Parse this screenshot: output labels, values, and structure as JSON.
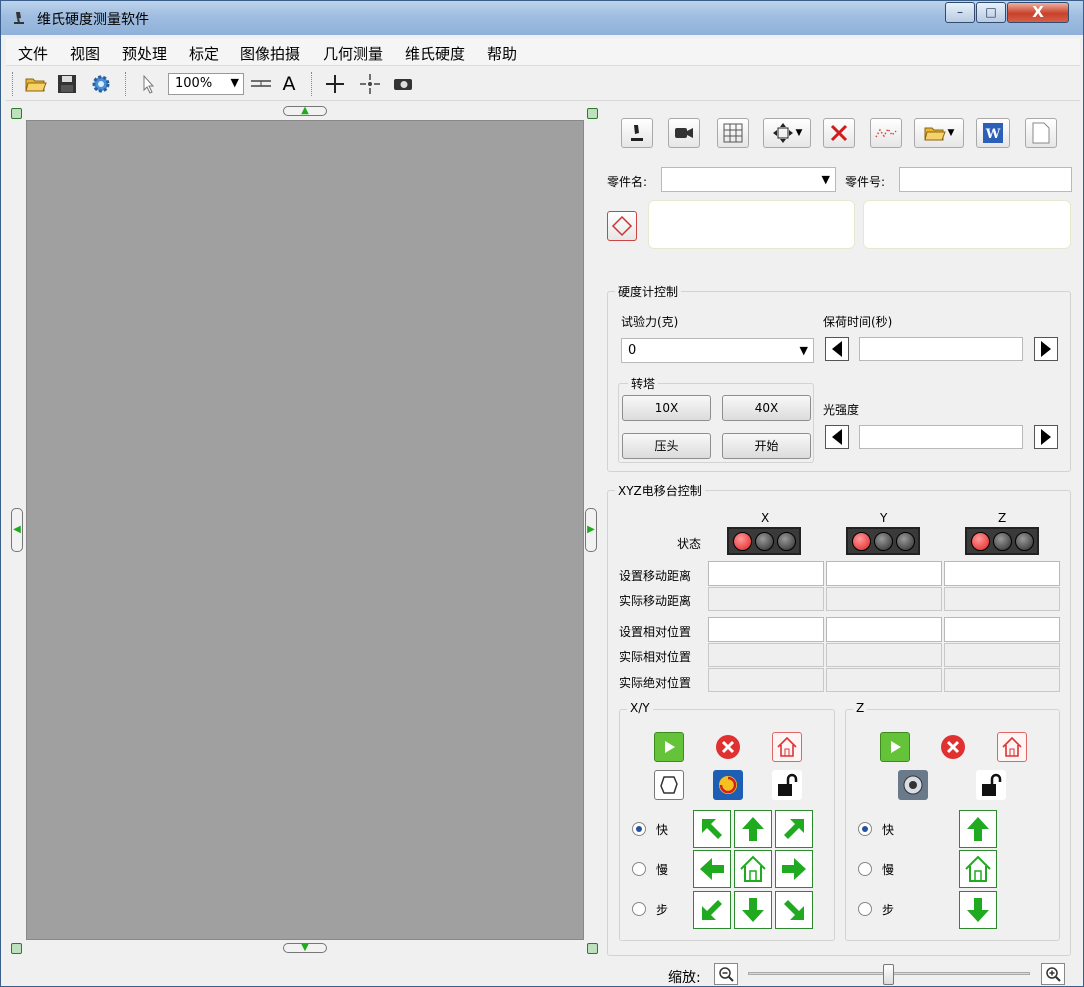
{
  "window": {
    "title": "维氏硬度测量软件",
    "min": "–",
    "max": "□",
    "close": "X"
  },
  "menu": [
    "文件",
    "视图",
    "预处理",
    "标定",
    "图像拍摄",
    "几何测量",
    "维氏硬度",
    "帮助"
  ],
  "toolbar": {
    "zoom_value": "100%",
    "text_tool": "A"
  },
  "part": {
    "name_label": "零件名:",
    "name_value": "",
    "number_label": "零件号:",
    "number_value": ""
  },
  "hardness": {
    "group_title": "硬度计控制",
    "force_label": "试验力(克)",
    "force_value": "0",
    "dwell_label": "保荷时间(秒)",
    "dwell_value": "",
    "turret_title": "转塔",
    "btn_10x": "10X",
    "btn_40x": "40X",
    "btn_indenter": "压头",
    "btn_start": "开始",
    "light_label": "光强度",
    "light_value": ""
  },
  "xyz": {
    "group_title": "XYZ电移台控制",
    "axes": [
      "X",
      "Y",
      "Z"
    ],
    "status_label": "状态",
    "rows": [
      "设置移动距离",
      "实际移动距离",
      "设置相对位置",
      "实际相对位置",
      "实际绝对位置"
    ],
    "xy_title": "X/Y",
    "z_title": "Z",
    "speed_options": [
      "快",
      "慢",
      "步"
    ],
    "selected_speed": "快"
  },
  "zoom_bar": {
    "label": "缩放:"
  },
  "colors": {
    "accent_green": "#1faa1f",
    "titlebar": "#9fbde0",
    "canvas": "#a0a0a0",
    "status_red": "#e02020"
  }
}
